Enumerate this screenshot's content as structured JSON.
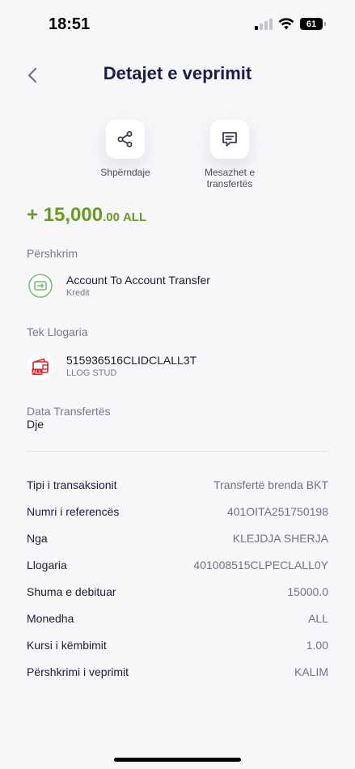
{
  "status_bar": {
    "time": "18:51",
    "battery": "61"
  },
  "header": {
    "title": "Detajet e veprimit"
  },
  "actions": [
    {
      "label": "Shpërndaje",
      "icon": "share-icon"
    },
    {
      "label": "Mesazhet e transfertës",
      "icon": "message-icon"
    }
  ],
  "amount": {
    "main": "+ 15,000",
    "decimals": ".00",
    "currency": "ALL"
  },
  "description": {
    "label": "Përshkrim",
    "title": "Account To Account Transfer",
    "subtitle": "Kredit",
    "icon": "transfer-icon"
  },
  "account": {
    "label": "Tek Llogaria",
    "title": "515936516CLIDCLALL3T",
    "subtitle": "LLOG STUD",
    "icon": "wallet-icon",
    "icon_badge": "ALL"
  },
  "transfer_date": {
    "label": "Data Transfertës",
    "value": "Dje"
  },
  "details": [
    {
      "label": "Tipi i transaksionit",
      "value": "Transfertë brenda BKT"
    },
    {
      "label": "Numri i referencës",
      "value": "401OITA251750198"
    },
    {
      "label": "Nga",
      "value": "KLEJDJA SHERJA"
    },
    {
      "label": "Llogaria",
      "value": "401008515CLPECLALL0Y"
    },
    {
      "label": "Shuma e debituar",
      "value": "15000.0"
    },
    {
      "label": "Monedha",
      "value": "ALL"
    },
    {
      "label": "Kursi i këmbimit",
      "value": "1.00"
    },
    {
      "label": "Përshkrimi i veprimit",
      "value": "KALIM"
    }
  ],
  "colors": {
    "accent_green": "#6a9a26",
    "title_navy": "#1a1d4a",
    "account_red": "#d8232a"
  }
}
